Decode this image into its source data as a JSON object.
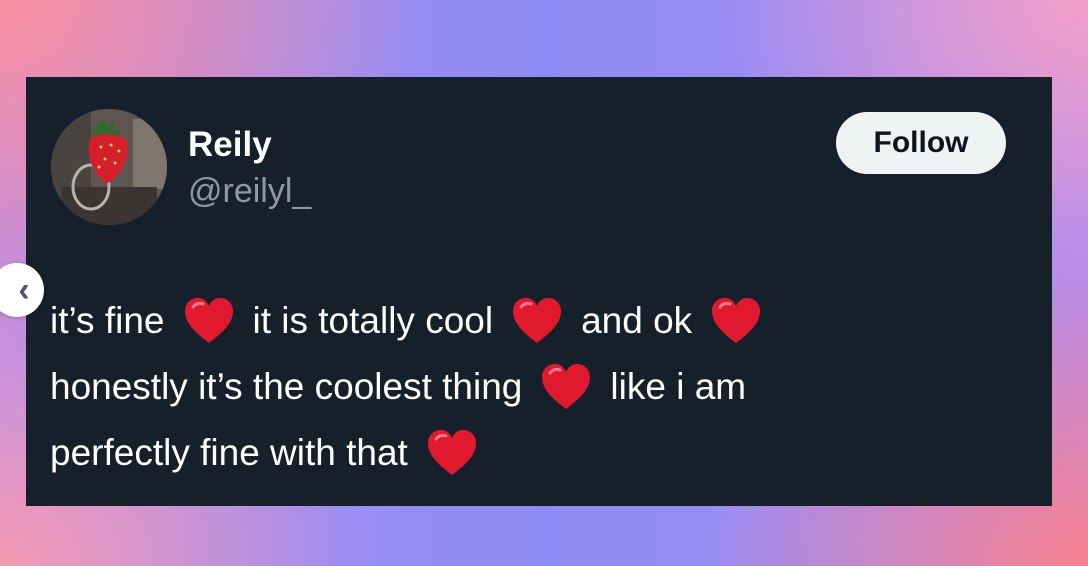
{
  "profile": {
    "display_name": "Reily",
    "handle": "@reilyl_",
    "avatar_icon": "strawberry-avatar"
  },
  "actions": {
    "follow_label": "Follow"
  },
  "tweet": {
    "line1": {
      "a": "it’s fine",
      "b": "it is totally cool",
      "c": "and ok"
    },
    "line2": {
      "a": "honestly it’s the coolest thing",
      "b": "like i am"
    },
    "line3": {
      "a": "perfectly fine with that"
    },
    "emoji": "heart-icon"
  },
  "nav": {
    "prev_icon": "chevron-left-icon",
    "prev_glyph": "‹"
  },
  "colors": {
    "card_background": "#15202b",
    "handle_text": "#8b98a5",
    "follow_button": "#eff3f4",
    "heart": "#e0192f"
  }
}
